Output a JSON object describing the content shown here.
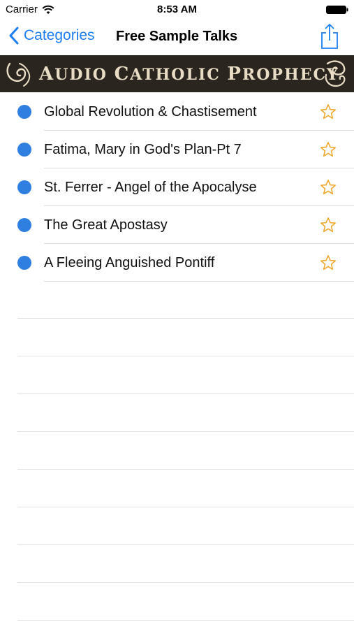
{
  "status_bar": {
    "carrier": "Carrier",
    "time": "8:53 AM",
    "icons": [
      "wifi-icon",
      "battery-icon"
    ]
  },
  "nav": {
    "back_label": "Categories",
    "title": "Free Sample Talks",
    "share_icon": "share-icon"
  },
  "banner": {
    "text_first": "A",
    "text_rest": "UDIO ",
    "word2_first": "C",
    "word2_rest": "ATHOLIC ",
    "word3_first": "P",
    "word3_rest": "ROPHECY"
  },
  "list": {
    "items": [
      {
        "title": "Global Revolution & Chastisement"
      },
      {
        "title": "Fatima, Mary in God's Plan-Pt 7"
      },
      {
        "title": "St. Ferrer - Angel of the Apocalyse"
      },
      {
        "title": "The Great Apostasy"
      },
      {
        "title": "A Fleeing Anguished Pontiff"
      }
    ],
    "empty_rows": 9
  },
  "colors": {
    "accent": "#1f7ef2",
    "dot": "#2f7fe0",
    "star": "#f0a830",
    "banner_bg": "#2b2520",
    "banner_text": "#e8dcc4"
  }
}
